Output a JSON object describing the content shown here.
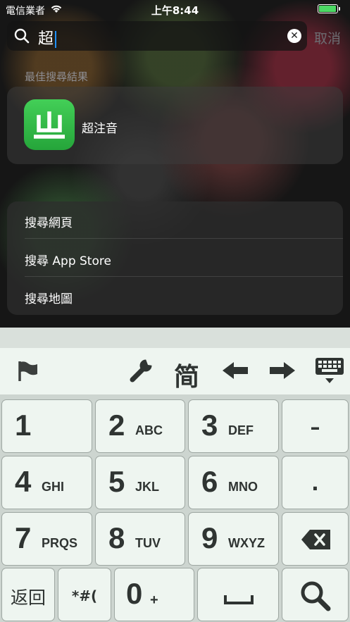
{
  "status_bar": {
    "carrier": "電信業者",
    "time": "上午8:44"
  },
  "search": {
    "query": "超",
    "cancel_label": "取消"
  },
  "best_result": {
    "section_label": "最佳搜尋結果",
    "app_name": "超注音",
    "icon_glyph": "ㄓ"
  },
  "suggestions": [
    {
      "label": "搜尋網頁"
    },
    {
      "label": "搜尋 App Store"
    },
    {
      "label": "搜尋地圖"
    }
  ],
  "keyboard": {
    "toolbar": {
      "simplified_label": "简"
    },
    "keys": [
      {
        "num": "1",
        "letters": ""
      },
      {
        "num": "2",
        "letters": "ABC"
      },
      {
        "num": "3",
        "letters": "DEF"
      },
      {
        "num": "4",
        "letters": "GHI"
      },
      {
        "num": "5",
        "letters": "JKL"
      },
      {
        "num": "6",
        "letters": "MNO"
      },
      {
        "num": "7",
        "letters": "PRQS"
      },
      {
        "num": "8",
        "letters": "TUV"
      },
      {
        "num": "9",
        "letters": "WXYZ"
      }
    ],
    "dash_label": "–",
    "dot_label": ".",
    "return_label": "返回",
    "symbols_label": "*#(",
    "zero": {
      "num": "0",
      "letters": "+"
    }
  }
}
